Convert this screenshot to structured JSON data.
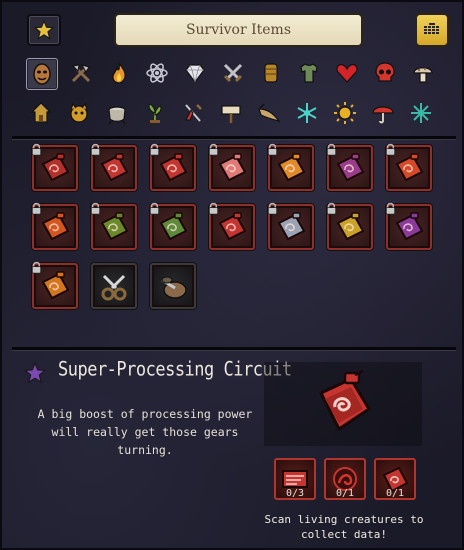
{
  "header": {
    "title": "Survivor Items",
    "favorites_icon": "star-icon",
    "grid_toggle_icon": "grid-icon",
    "accent_color": "#e8c041"
  },
  "categories": {
    "row1": [
      "mask-icon",
      "tools-icon",
      "fire-icon",
      "atom-science-icon",
      "gem-icon",
      "crossed-swords-icon",
      "armor-icon",
      "shirt-icon",
      "heart-icon",
      "skull-icon",
      "mushroom-icon"
    ],
    "row2": [
      "house-icon",
      "creature-mask-icon",
      "pot-icon",
      "farm-plant-icon",
      "dress-icon",
      "sign-icon",
      "horn-icon",
      "snowflake-icon",
      "sun-icon",
      "umbrella-icon",
      "ice-crystal-icon"
    ],
    "selected": "mask-icon"
  },
  "items": {
    "rows": [
      [
        {
          "type": "circuit",
          "locked": true,
          "color": "#b3302b"
        },
        {
          "type": "circuit",
          "locked": true,
          "color": "#c23531"
        },
        {
          "type": "circuit",
          "locked": true,
          "color": "#c23531"
        },
        {
          "type": "circuit",
          "locked": true,
          "color": "#e07a76"
        },
        {
          "type": "circuit",
          "locked": true,
          "color": "#e08a2a"
        },
        {
          "type": "circuit",
          "locked": true,
          "color": "#9a3c8a"
        },
        {
          "type": "circuit",
          "locked": true,
          "color": "#d44a28"
        }
      ],
      [
        {
          "type": "circuit",
          "locked": true,
          "color": "#d4551e"
        },
        {
          "type": "circuit",
          "locked": true,
          "color": "#6a8a2a"
        },
        {
          "type": "circuit",
          "locked": true,
          "color": "#5e8a3a"
        },
        {
          "type": "circuit",
          "locked": true,
          "color": "#c23531"
        },
        {
          "type": "circuit",
          "locked": true,
          "color": "#9aa3b3"
        },
        {
          "type": "circuit",
          "locked": true,
          "color": "#c9a227"
        },
        {
          "type": "circuit",
          "locked": true,
          "color": "#8a3a9a"
        }
      ],
      [
        {
          "type": "circuit",
          "locked": true,
          "color": "#d4761e"
        },
        {
          "type": "clippers",
          "locked": false,
          "color": "#888888"
        },
        {
          "type": "tool-bundle",
          "locked": false,
          "color": "#8a6a4a"
        }
      ]
    ]
  },
  "detail": {
    "title": "Super-Processing Circuit",
    "description": "A big boost of processing power will really get those gears turning.",
    "requirements": [
      {
        "name": "scan-data-icon",
        "count": "0/3"
      },
      {
        "name": "bio-data-icon",
        "count": "0/1"
      },
      {
        "name": "circuit-icon",
        "count": "0/1"
      }
    ],
    "hint": "Scan living creatures to collect data!"
  }
}
